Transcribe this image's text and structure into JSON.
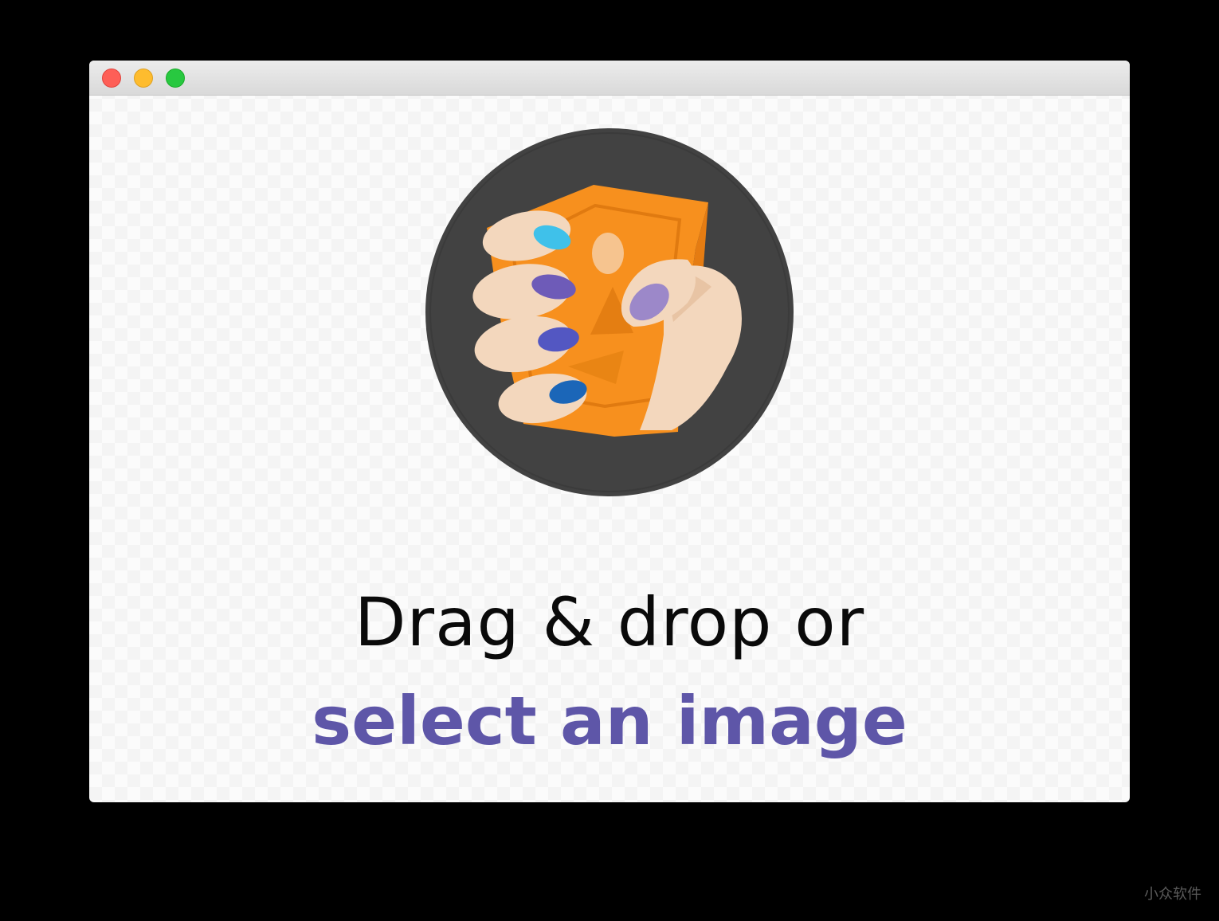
{
  "window": {
    "controls": {
      "close": "close-button",
      "minimize": "minimize-button",
      "zoom": "zoom-button"
    }
  },
  "illustration": {
    "icon": "hand-holding-money-icon",
    "colors": {
      "circle": "#424242",
      "money": "#f7901e",
      "skin": "#f3d7bd",
      "nail_cyan": "#3fc1ea",
      "nail_violet": "#6e5bb8",
      "nail_indigo": "#5357c2",
      "nail_blue": "#1b66b8",
      "nail_lavender": "#9c88c9"
    }
  },
  "prompt": {
    "line1": "Drag & drop or",
    "line2": "select an image"
  },
  "watermark": "小众软件",
  "colors": {
    "accent": "#5e56a8",
    "text": "#0a0a0a",
    "background": "#000000"
  }
}
